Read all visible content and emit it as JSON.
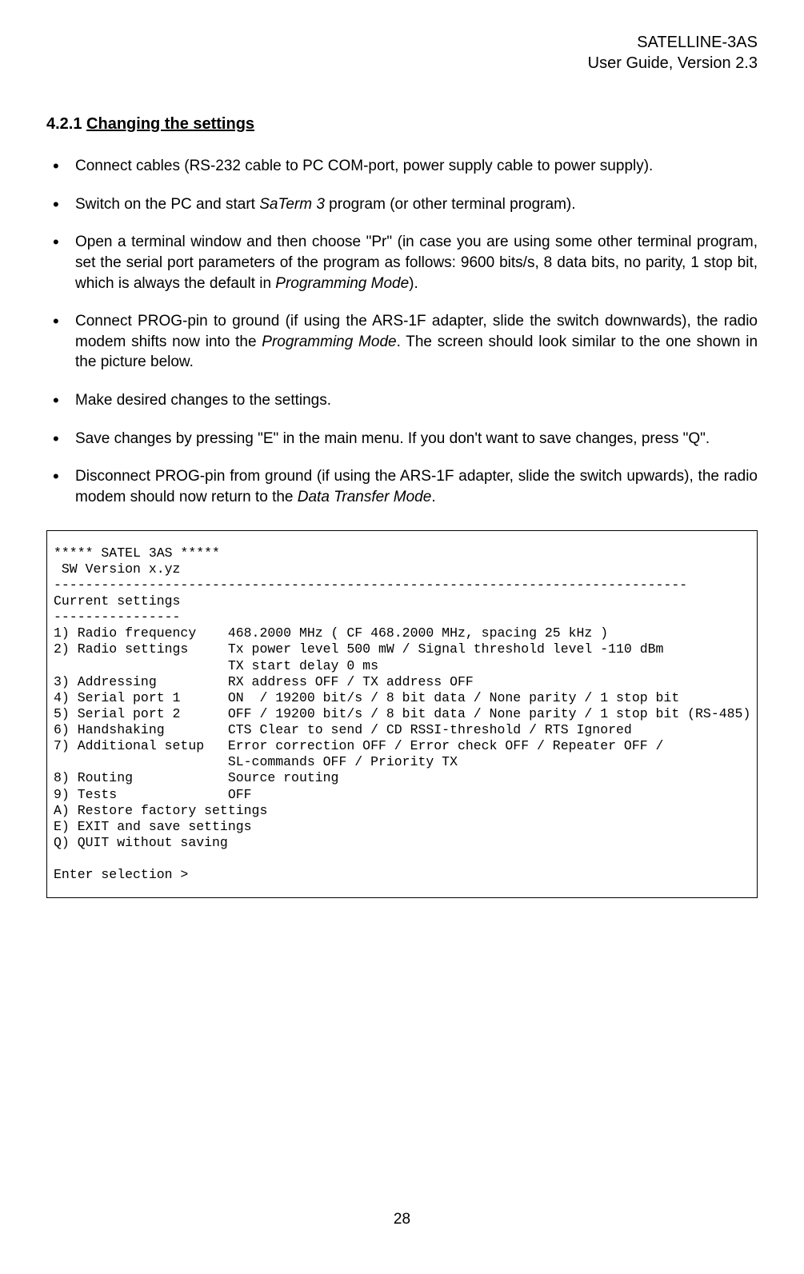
{
  "header": {
    "line1": "SATELLINE-3AS",
    "line2": "User Guide, Version 2.3"
  },
  "section": {
    "number": "4.2.1",
    "title": "Changing the settings"
  },
  "bullets": [
    {
      "html": "Connect cables (RS-232 cable to PC COM-port, power supply cable to power supply)."
    },
    {
      "html": "Switch on the PC and start <span class=\"italic\">SaTerm 3</span> program (or other terminal program)."
    },
    {
      "html": "Open a terminal window and then choose  \"Pr\" (in case you are using some other terminal program, set the serial port  parameters of the program as follows: 9600 bits/s, 8 data bits, no parity, 1 stop bit, which is always the default in <span class=\"italic\">Programming Mode</span>)."
    },
    {
      "html": "Connect PROG-pin to ground (if using the ARS-1F adapter, slide the switch downwards), the radio modem shifts now into the <span class=\"italic\">Programming Mode</span>. The screen should look similar to the one shown in the picture below."
    },
    {
      "html": "Make desired changes to the settings."
    },
    {
      "html": "Save changes by pressing \"E\" in the main menu. If you don't want to save changes, press \"Q\"."
    },
    {
      "html": "Disconnect PROG-pin from ground (if using the ARS-1F adapter, slide the switch upwards), the radio modem should now return to the <span class=\"italic\">Data Transfer Mode</span>."
    }
  ],
  "terminal": {
    "lines": [
      "***** SATEL 3AS *****",
      " SW Version x.yz",
      "--------------------------------------------------------------------------------",
      "Current settings",
      "----------------",
      "1) Radio frequency    468.2000 MHz ( CF 468.2000 MHz, spacing 25 kHz )",
      "2) Radio settings     Tx power level 500 mW / Signal threshold level -110 dBm",
      "                      TX start delay 0 ms",
      "3) Addressing         RX address OFF / TX address OFF",
      "4) Serial port 1      ON  / 19200 bit/s / 8 bit data / None parity / 1 stop bit",
      "5) Serial port 2      OFF / 19200 bit/s / 8 bit data / None parity / 1 stop bit (RS-485)",
      "6) Handshaking        CTS Clear to send / CD RSSI-threshold / RTS Ignored",
      "7) Additional setup   Error correction OFF / Error check OFF / Repeater OFF /",
      "                      SL-commands OFF / Priority TX",
      "8) Routing            Source routing",
      "9) Tests              OFF",
      "A) Restore factory settings",
      "E) EXIT and save settings",
      "Q) QUIT without saving",
      "",
      "Enter selection >"
    ]
  },
  "page_number": "28"
}
